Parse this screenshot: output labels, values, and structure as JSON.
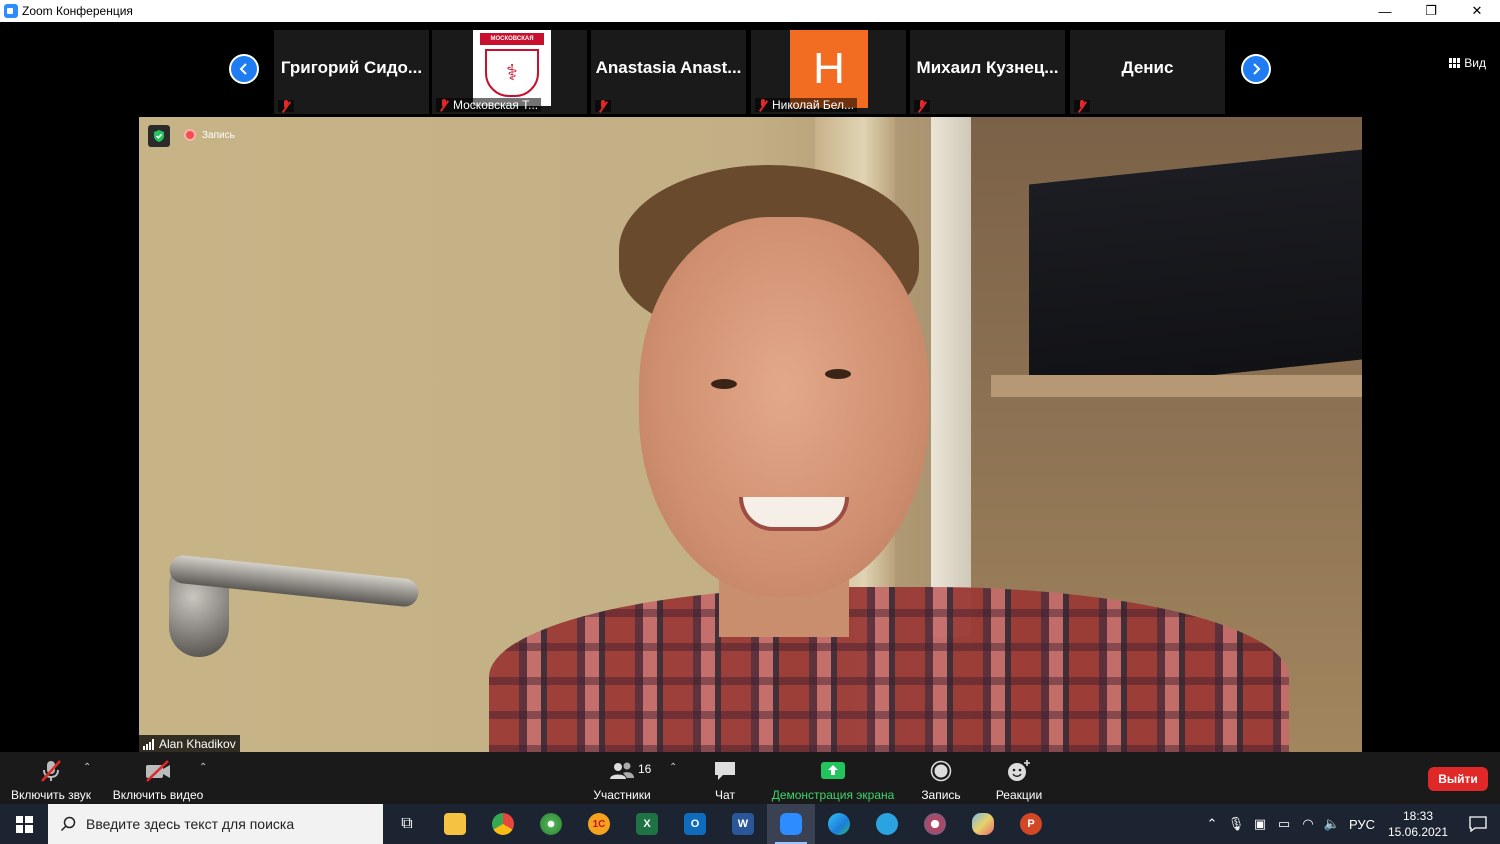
{
  "window": {
    "title": "Zoom Конференция",
    "minimize_glyph": "—",
    "maximize_glyph": "❐",
    "close_glyph": "✕"
  },
  "view_button": {
    "label": "Вид"
  },
  "participants": [
    {
      "name": "Григорий  Сидо...",
      "muted": true,
      "footer": ""
    },
    {
      "name": "",
      "muted": true,
      "footer": "Московская Т...",
      "logo_text": "МОСКОВСКАЯ",
      "logo_glyph": "⚕"
    },
    {
      "name": "Anastasia  Anast...",
      "muted": true,
      "footer": ""
    },
    {
      "name": "",
      "muted": true,
      "footer": "Николай Бел...",
      "avatar_letter": "H",
      "avatar_color": "#f26d21"
    },
    {
      "name": "Михаил  Кузнец...",
      "muted": true,
      "footer": ""
    },
    {
      "name": "Денис",
      "muted": true,
      "footer": ""
    }
  ],
  "main_video": {
    "speaker_name": "Alan Khadikov",
    "recording_label": "Запись",
    "encryption_icon": "shield-check-icon"
  },
  "toolbar": {
    "mute_label": "Включить звук",
    "video_label": "Включить видео",
    "participants_label": "Участники",
    "participants_count": "16",
    "chat_label": "Чат",
    "share_label": "Демонстрация экрана",
    "record_label": "Запись",
    "reactions_label": "Реакции",
    "leave_label": "Выйти",
    "share_color": "#3fd46a",
    "leave_color": "#e02828"
  },
  "taskbar": {
    "search_placeholder": "Введите здесь текст для поиска",
    "apps": [
      {
        "name": "task-view",
        "glyph": "⧉",
        "color": ""
      },
      {
        "name": "file-explorer",
        "glyph": "",
        "color": "#f5c242"
      },
      {
        "name": "chrome",
        "glyph": "",
        "color": "#e8453c"
      },
      {
        "name": "maps",
        "glyph": "",
        "color": "#4caf50"
      },
      {
        "name": "1c",
        "glyph": "1С",
        "color": "#f4a31c"
      },
      {
        "name": "excel",
        "glyph": "X",
        "color": "#1f7244"
      },
      {
        "name": "outlook",
        "glyph": "O",
        "color": "#0f6cbd"
      },
      {
        "name": "word",
        "glyph": "W",
        "color": "#2b579a"
      },
      {
        "name": "zoom",
        "glyph": "",
        "color": "#2d8cff"
      },
      {
        "name": "edge",
        "glyph": "",
        "color": "#1ba0c8"
      },
      {
        "name": "telegram",
        "glyph": "",
        "color": "#2aa3e0"
      },
      {
        "name": "app-mixed",
        "glyph": "",
        "color": "#c04060"
      },
      {
        "name": "paint",
        "glyph": "",
        "color": "#7ab8e8"
      },
      {
        "name": "powerpoint",
        "glyph": "P",
        "color": "#d24726"
      }
    ],
    "lang": "РУС",
    "time": "18:33",
    "date": "15.06.2021"
  }
}
